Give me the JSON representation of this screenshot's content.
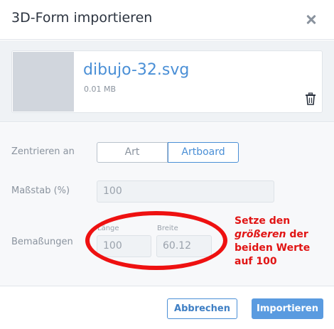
{
  "dialog": {
    "title": "3D-Form importieren"
  },
  "file": {
    "name": "dibujo-32.svg",
    "size": "0.01 MB"
  },
  "center": {
    "label": "Zentrieren an",
    "options": [
      "Art",
      "Artboard"
    ],
    "selected": "Artboard"
  },
  "scale": {
    "label": "Maßstab (%)",
    "value": "100"
  },
  "dimensions": {
    "label": "Bemaßungen",
    "length_label": "Länge",
    "length_value": "100",
    "width_label": "Breite",
    "width_value": "60.12"
  },
  "annotation": {
    "line1": "Setze den",
    "line2_em": "größeren",
    "line2_rest": " der",
    "line3": "beiden Werte",
    "line4": "auf 100",
    "color": "#e11414"
  },
  "footer": {
    "cancel_label": "Abbrechen",
    "import_label": "Importieren"
  },
  "colors": {
    "accent": "#4a8fd6",
    "annotation_red": "#ee1111"
  }
}
